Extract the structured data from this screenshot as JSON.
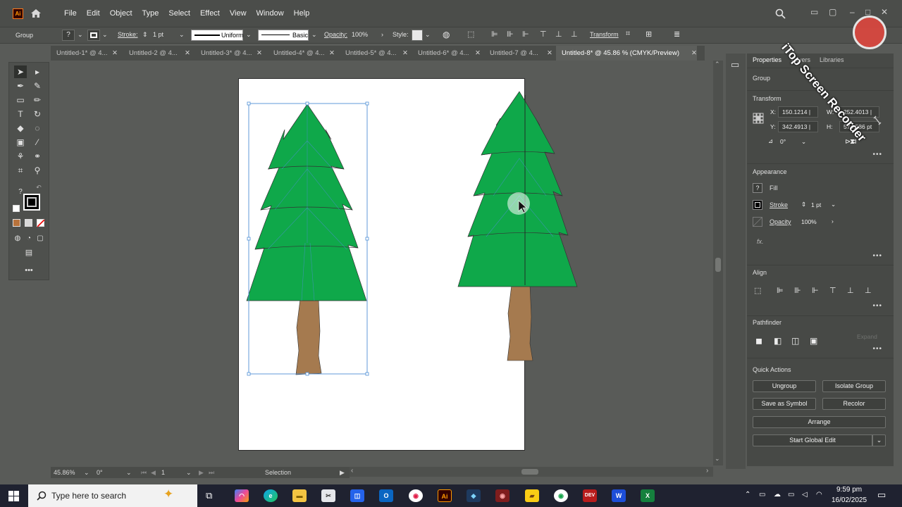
{
  "menubar": {
    "logo": "Ai",
    "items": [
      "File",
      "Edit",
      "Object",
      "Type",
      "Select",
      "Effect",
      "View",
      "Window",
      "Help"
    ]
  },
  "control": {
    "selection_type": "Group",
    "stroke_label": "Stroke:",
    "stroke_weight": "1 pt",
    "profile": "Uniform",
    "brush": "Basic",
    "opacity_label": "Opacity:",
    "opacity_value": "100%",
    "style_label": "Style:",
    "transform_label": "Transform"
  },
  "tabs": [
    {
      "label": "Untitled-1* @ 4...",
      "active": false
    },
    {
      "label": "Untitled-2 @ 4...",
      "active": false
    },
    {
      "label": "Untitled-3* @ 4...",
      "active": false
    },
    {
      "label": "Untitled-4* @ 4...",
      "active": false
    },
    {
      "label": "Untitled-5* @ 4...",
      "active": false
    },
    {
      "label": "Untitled-6* @ 4...",
      "active": false
    },
    {
      "label": "Untitled-7 @ 4...",
      "active": false
    },
    {
      "label": "Untitled-8* @ 45.86 % (CMYK/Preview)",
      "active": true
    }
  ],
  "status": {
    "zoom": "45.86%",
    "rotation": "0°",
    "artboard": "1",
    "tool": "Selection"
  },
  "panel": {
    "tabs": [
      "Properties",
      "Layers",
      "Libraries"
    ],
    "selection": "Group",
    "transform": {
      "title": "Transform",
      "x_label": "X:",
      "x": "150.1214 |",
      "y_label": "Y:",
      "y": "342.4913 |",
      "w_label": "W:",
      "w": "252.4013 |",
      "h_label": "H:",
      "h": "574.586 pt",
      "angle": "0°"
    },
    "appearance": {
      "title": "Appearance",
      "fill_label": "Fill",
      "stroke_label": "Stroke",
      "stroke_value": "1 pt",
      "opacity_label": "Opacity",
      "opacity_value": "100%",
      "fx_label": "fx."
    },
    "align_title": "Align",
    "pathfinder": {
      "title": "Pathfinder",
      "expand": "Expand"
    },
    "quick_actions": {
      "title": "Quick Actions",
      "ungroup": "Ungroup",
      "isolate": "Isolate Group",
      "save_symbol": "Save as Symbol",
      "recolor": "Recolor",
      "arrange": "Arrange",
      "global_edit": "Start Global Edit"
    }
  },
  "taskbar": {
    "search_placeholder": "Type here to search",
    "time": "9:59 pm",
    "date": "16/02/2025"
  },
  "watermark": "iTop Screen Recorder",
  "colors": {
    "tree_green": "#0fa84a",
    "trunk_brown": "#a57a4f",
    "selection_blue": "#4f8fd6",
    "ai_orange": "#ff9a00"
  }
}
